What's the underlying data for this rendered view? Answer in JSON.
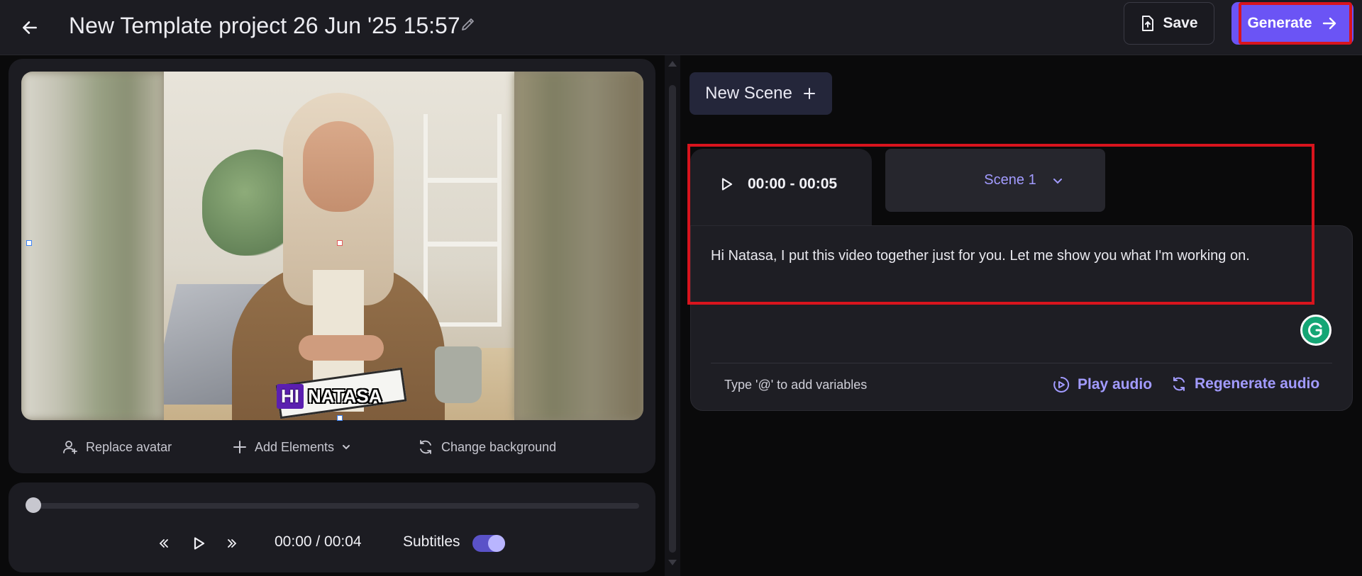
{
  "header": {
    "back_icon": "arrow-left-icon",
    "title": "New Template project 26 Jun '25 15:57",
    "edit_icon": "pencil-icon",
    "save_label": "Save",
    "generate_label": "Generate"
  },
  "preview": {
    "caption_word1": "HI",
    "caption_word2": "NATASA",
    "tools": {
      "replace_avatar": "Replace avatar",
      "add_elements": "Add Elements",
      "change_background": "Change background"
    }
  },
  "timeline": {
    "progress": 0,
    "time": "00:00 / 00:04",
    "subtitles_label": "Subtitles",
    "subtitles_on": true
  },
  "scenes": {
    "new_scene_label": "New Scene",
    "active": {
      "time_range": "00:00 - 00:05",
      "name": "Scene 1",
      "script": "Hi Natasa, I put this video together just for you. Let me show you what I'm working on.",
      "variables_hint": "Type '@' to add variables",
      "play_audio": "Play audio",
      "regenerate_audio": "Regenerate audio"
    }
  },
  "colors": {
    "accent": "#6b54f5",
    "link": "#a29bff",
    "highlight": "#d8141d",
    "grammarly": "#15a675"
  }
}
